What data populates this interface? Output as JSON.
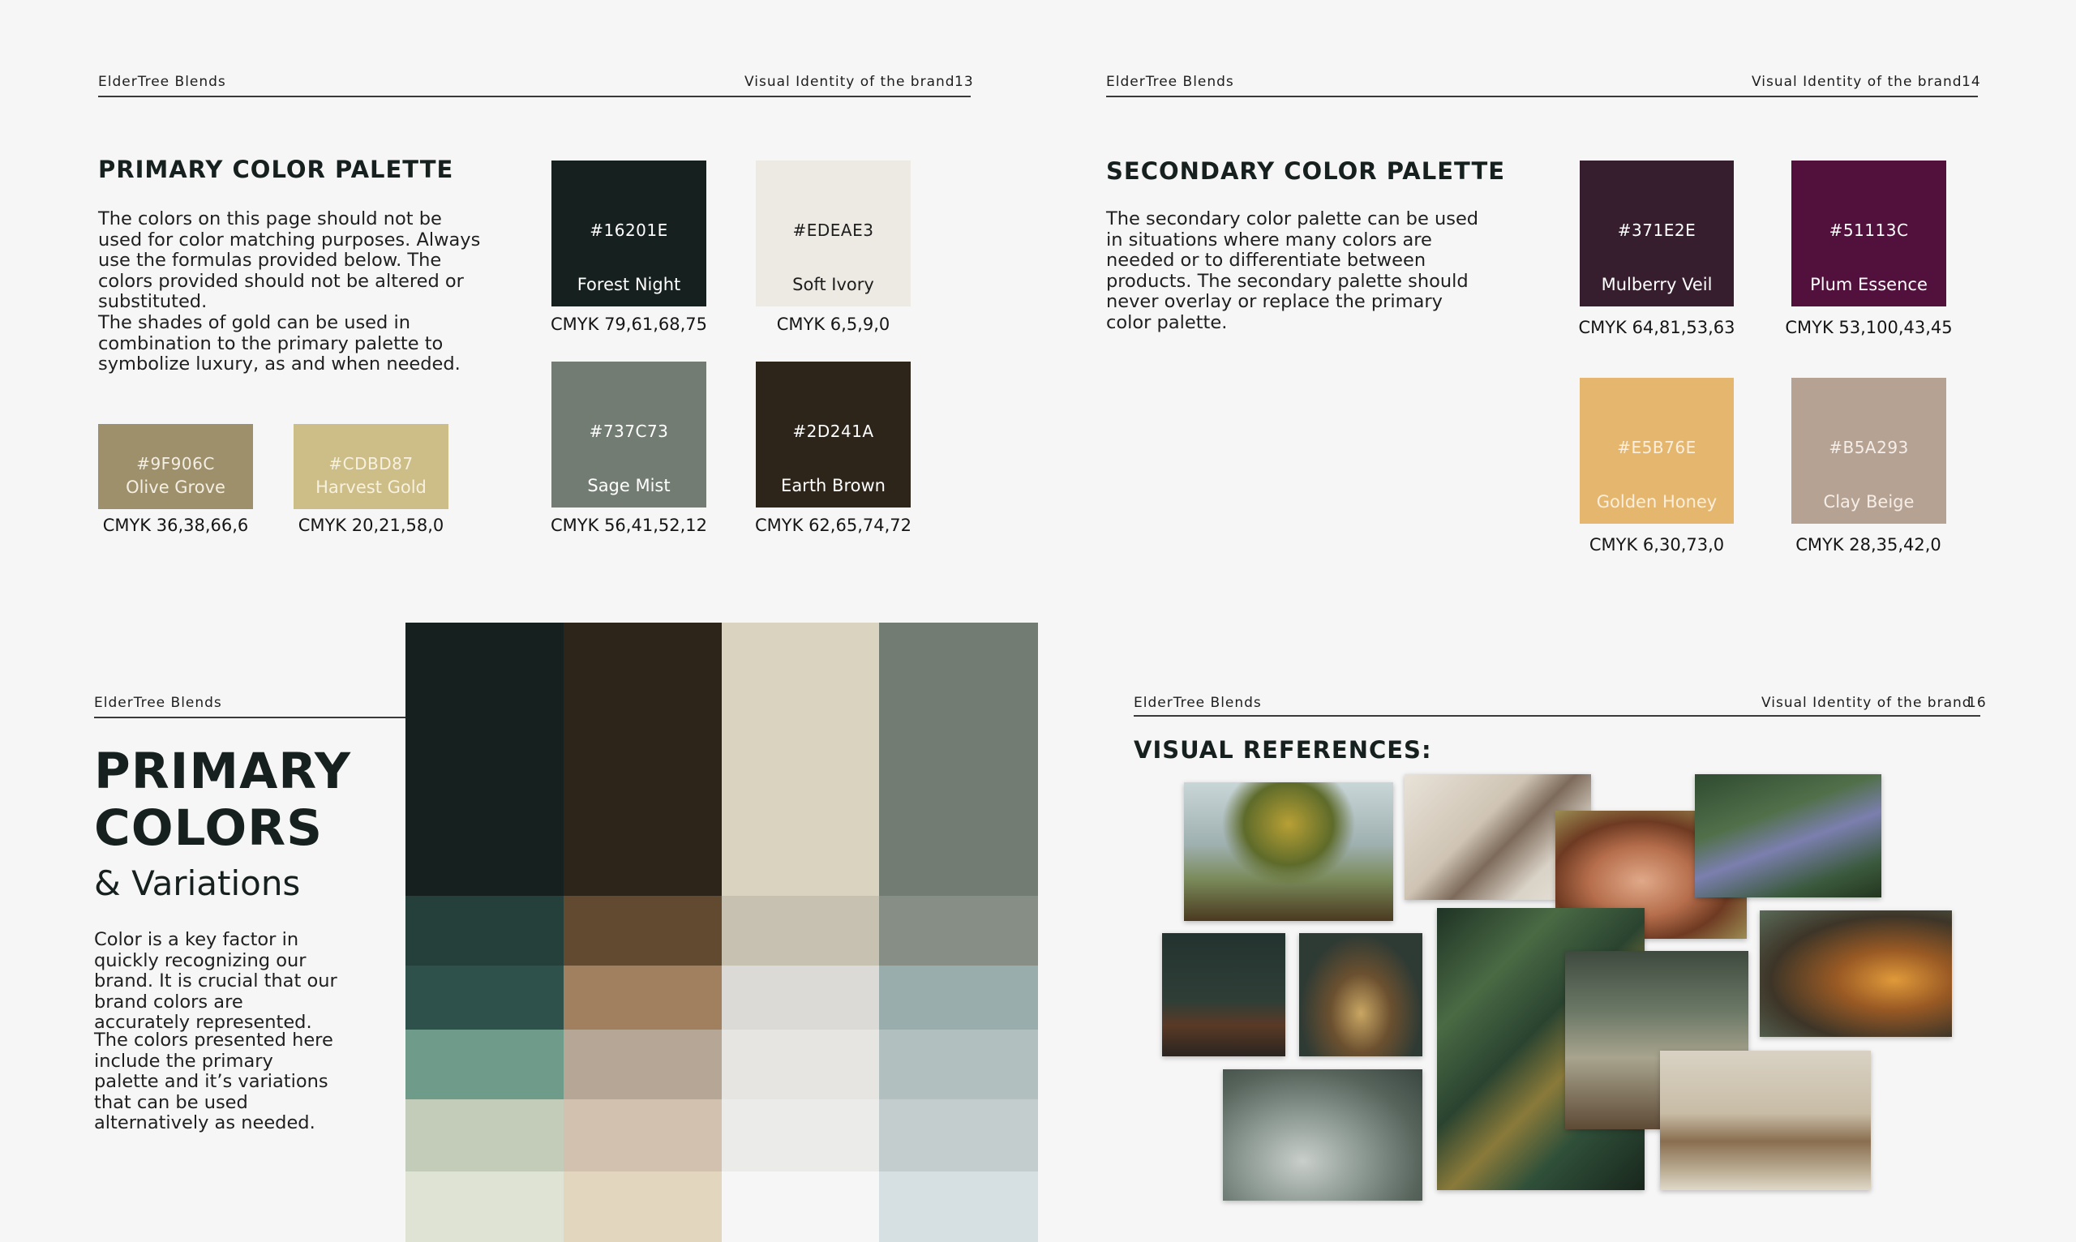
{
  "brand": "ElderTree Blends",
  "page13": {
    "section": "Visual Identity of the brand",
    "page_num": "13",
    "title": "PRIMARY COLOR PALETTE",
    "para1": "The colors on this page should not be used for color matching purposes. Always use the formulas provided below. The colors provided should not be altered or substituted.",
    "para2": "The shades of gold can be used in combination to the primary palette to symbolize luxury, as and when needed.",
    "swatches": [
      {
        "hex": "#16201E",
        "name": "Forest Night",
        "cmyk": "CMYK 79,61,68,75",
        "color": "#16201e"
      },
      {
        "hex": "#EDEAE3",
        "name": "Soft Ivory",
        "cmyk": "CMYK 6,5,9,0",
        "color": "#edeae3"
      },
      {
        "hex": "#737C73",
        "name": "Sage Mist",
        "cmyk": "CMYK 56,41,52,12",
        "color": "#737c73"
      },
      {
        "hex": "#2D241A",
        "name": "Earth Brown",
        "cmyk": "CMYK 62,65,74,72",
        "color": "#2d241a"
      },
      {
        "hex": "#9F906C",
        "name": "Olive Grove",
        "cmyk": "CMYK 36,38,66,6",
        "color": "#9f906c"
      },
      {
        "hex": "#CDBD87",
        "name": "Harvest Gold",
        "cmyk": "CMYK 20,21,58,0",
        "color": "#cdbd87"
      }
    ]
  },
  "page14": {
    "section": "Visual Identity of the brand",
    "page_num": "14",
    "title": "SECONDARY COLOR PALETTE",
    "para": "The secondary color palette can be used in situations where many colors are needed or to differentiate between products. The secondary palette should never overlay or replace the primary color palette.",
    "swatches": [
      {
        "hex": "#371E2E",
        "name": "Mulberry Veil",
        "cmyk": "CMYK 64,81,53,63",
        "color": "#371e2e"
      },
      {
        "hex": "#51113C",
        "name": "Plum Essence",
        "cmyk": "CMYK 53,100,43,45",
        "color": "#51113c"
      },
      {
        "hex": "#E5B76E",
        "name": "Golden Honey",
        "cmyk": "CMYK 6,30,73,0",
        "color": "#e5b76e"
      },
      {
        "hex": "#B5A293",
        "name": "Clay Beige",
        "cmyk": "CMYK 28,35,42,0",
        "color": "#b5a293"
      }
    ]
  },
  "page15": {
    "title_line1": "PRIMARY",
    "title_line2": "COLORS",
    "subtitle": "& Variations",
    "para1": "Color is a key factor in quickly recognizing our brand. It is crucial that our brand colors are accurately represented.",
    "para2": "The colors presented here include the primary palette and it’s variations that can be used alternatively as needed.",
    "grid_colors": [
      [
        "#16201e",
        "#2d241a",
        "#d9d3bf",
        "#737c73"
      ],
      [
        "#253f3a",
        "#624a30",
        "#c6c1b0",
        "#868e86"
      ],
      [
        "#2e524b",
        "#a1805f",
        "#dcdad6",
        "#9aadad"
      ],
      [
        "#6f9b8a",
        "#b6a696",
        "#e6e5e2",
        "#b1c0bf"
      ],
      [
        "#c2ccb9",
        "#d2c1af",
        "#ebebea",
        "#c3cdce"
      ],
      [
        "#dfe3d4",
        "#e2d6bf",
        "#f6f6f6",
        "#d6dfe1"
      ]
    ]
  },
  "page16": {
    "section": "Visual Identity of the brand",
    "page_num": "16",
    "title": "VISUAL REFERENCES:"
  }
}
